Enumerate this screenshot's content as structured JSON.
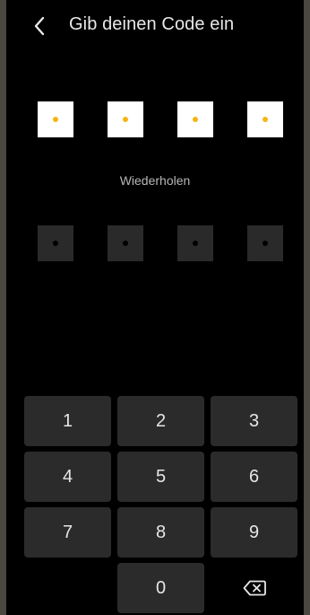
{
  "header": {
    "title": "Gib deinen Code ein",
    "back_icon": "chevron-left-icon"
  },
  "pin_first": {
    "length": 4,
    "filled_count": 4
  },
  "repeat_label": "Wiederholen",
  "pin_repeat": {
    "length": 4,
    "filled_count": 0
  },
  "keypad": {
    "keys": [
      "1",
      "2",
      "3",
      "4",
      "5",
      "6",
      "7",
      "8",
      "9",
      "",
      "0",
      ""
    ],
    "delete_icon": "backspace-icon"
  },
  "colors": {
    "accent_dot": "#f6b514",
    "screen_bg": "#000000",
    "key_bg": "#2b2b2b",
    "pin_filled_bg": "#ffffff",
    "pin_empty_bg": "#2a2a2a"
  }
}
